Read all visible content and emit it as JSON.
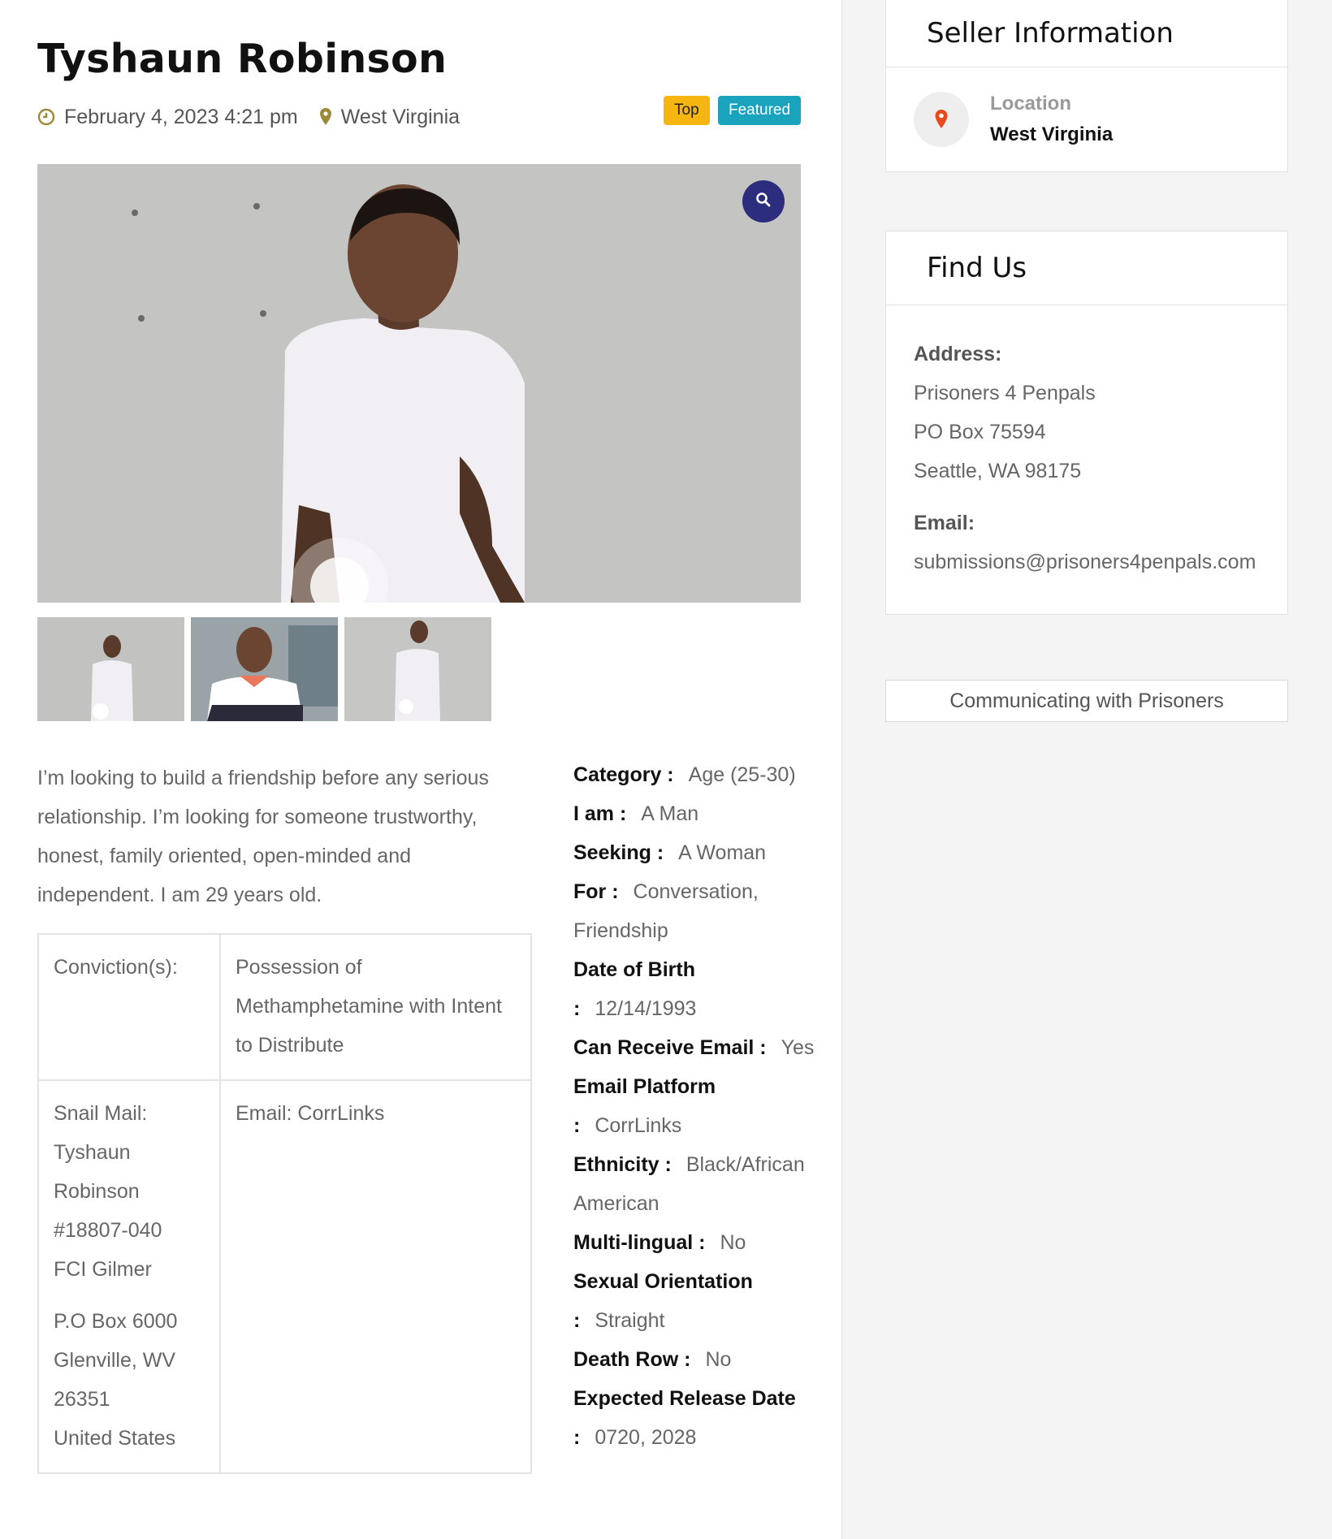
{
  "listing": {
    "title": "Tyshaun Robinson",
    "date": "February 4, 2023 4:21 pm",
    "location": "West Virginia",
    "badges": {
      "top": "Top",
      "featured": "Featured"
    },
    "description": "I’m looking to build a friendship before any serious relationship. I’m looking for someone trustworthy, honest, family oriented, open-minded and independent. I am 29 years old.",
    "gallery_count": 3
  },
  "table": {
    "conviction_label": "Conviction(s):",
    "conviction_value": "Possession of Methamphetamine with Intent to Distribute",
    "snail_label": "Snail Mail:",
    "snail_lines": [
      "Tyshaun",
      "Robinson",
      "#18807-040",
      "FCI Gilmer"
    ],
    "snail_addr": [
      "P.O Box 6000",
      "Glenville, WV",
      "26351",
      "United States"
    ],
    "email_value": "Email: CorrLinks"
  },
  "details": [
    {
      "label": "Category :",
      "value": "Age (25-30)"
    },
    {
      "label": "I am :",
      "value": "A Man"
    },
    {
      "label": "Seeking :",
      "value": "A Woman"
    },
    {
      "label": "For :",
      "value": "Conversation, Friendship"
    },
    {
      "label": "Date of Birth :",
      "value": "12/14/1993"
    },
    {
      "label": "Can Receive Email :",
      "value": "Yes"
    },
    {
      "label": "Email Platform :",
      "value": "CorrLinks"
    },
    {
      "label": "Ethnicity :",
      "value": "Black/African American"
    },
    {
      "label": "Multi-lingual :",
      "value": "No"
    },
    {
      "label": "Sexual Orientation :",
      "value": "Straight"
    },
    {
      "label": "Death Row :",
      "value": "No"
    },
    {
      "label": "Expected Release Date :",
      "value": "0720, 2028"
    }
  ],
  "sidebar": {
    "seller_title": "Seller Information",
    "location_label": "Location",
    "location_value": "West Virginia",
    "find_title": "Find Us",
    "address_label": "Address:",
    "address_lines": [
      "Prisoners 4 Penpals",
      "PO Box 75594",
      "Seattle, WA 98175"
    ],
    "email_label": "Email:",
    "email_value": "submissions@prisoners4penpals.com",
    "link_label": "Communicating with Prisoners"
  },
  "colors": {
    "badge_top": "#f7b50f",
    "badge_featured": "#1aa3bd",
    "zoom_button": "#2d2d7e",
    "location_pin": "#e8491d",
    "meta_icon": "#9a8a3a"
  },
  "icons": {
    "date": "clock-icon",
    "location": "map-pin-icon",
    "zoom": "search-icon"
  }
}
